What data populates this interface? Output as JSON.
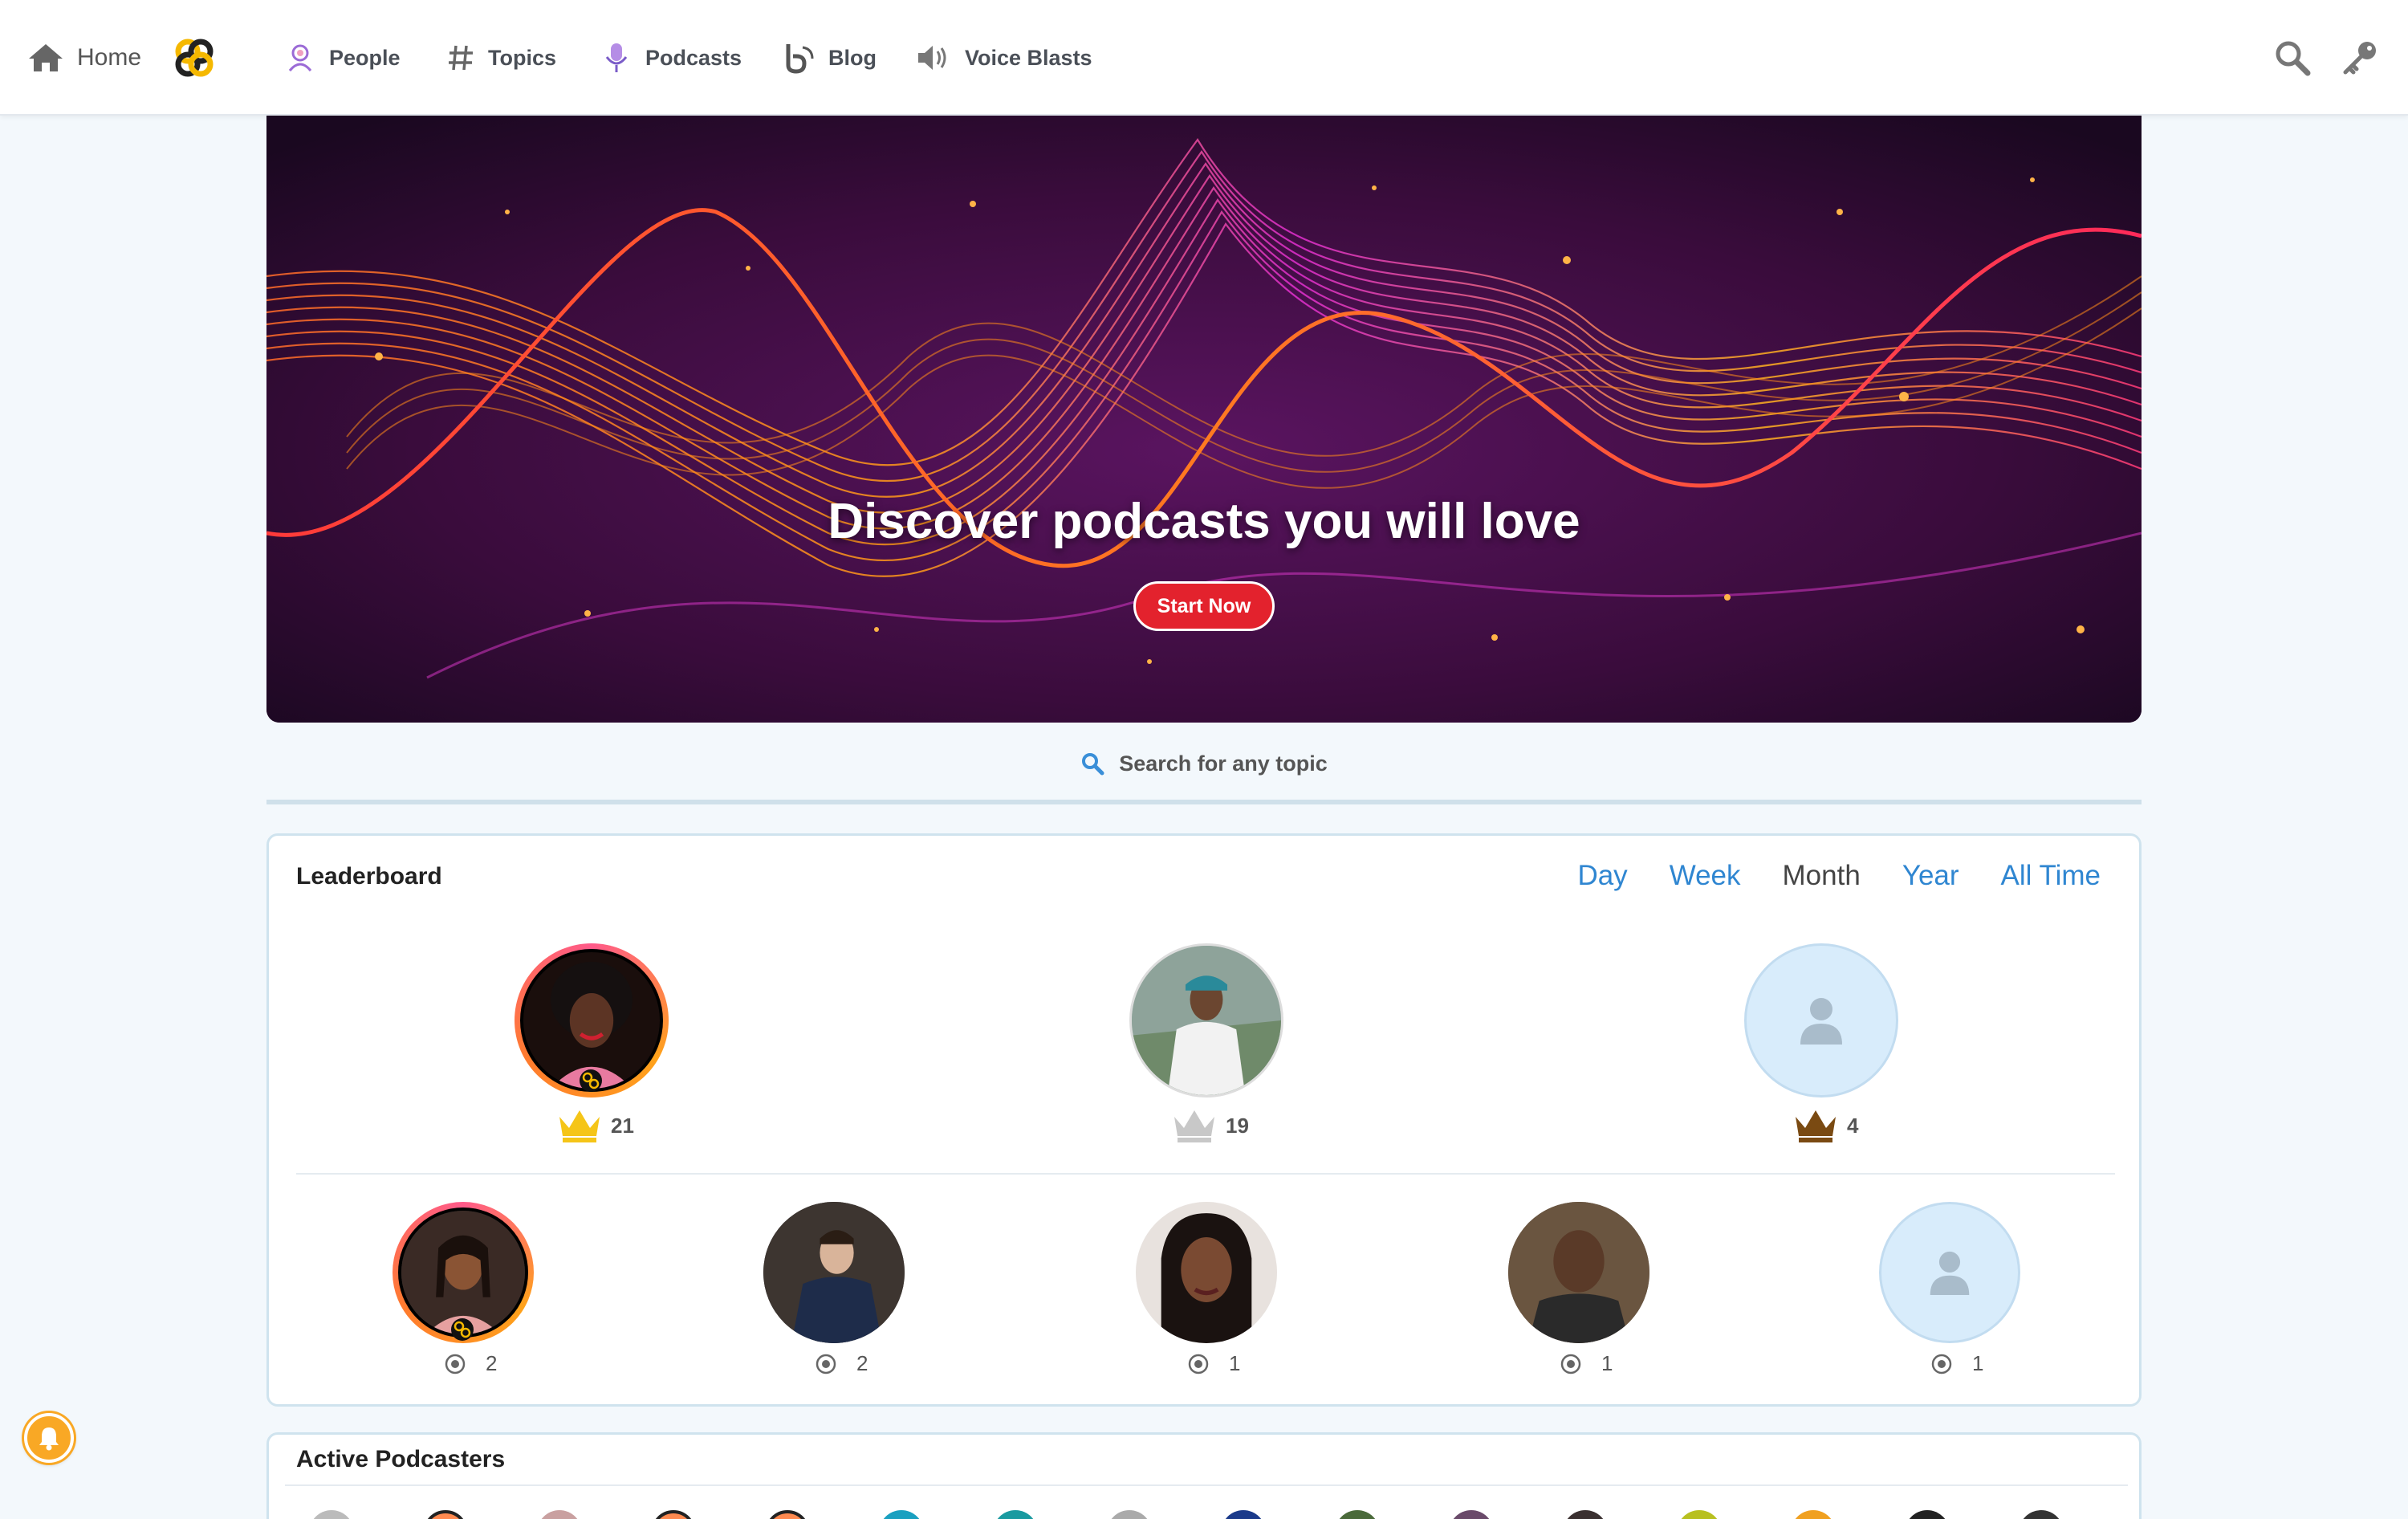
{
  "nav": {
    "home_label": "Home",
    "people_label": "People",
    "topics_label": "Topics",
    "podcasts_label": "Podcasts",
    "blog_label": "Blog",
    "voice_label": "Voice Blasts",
    "icons": [
      "home-icon",
      "brand-logo-icon",
      "people-icon",
      "hashtag-icon",
      "microphone-icon",
      "blog-icon",
      "speaker-icon",
      "search-icon",
      "key-icon"
    ]
  },
  "hero": {
    "title": "Discover podcasts you will love",
    "button_label": "Start Now"
  },
  "search": {
    "label": "Search for any topic"
  },
  "leaderboard": {
    "title": "Leaderboard",
    "tabs": [
      "Day",
      "Week",
      "Month",
      "Year",
      "All Time"
    ],
    "active_tab": "Month",
    "top3": [
      {
        "rank": 1,
        "score": "21",
        "crown": "gold"
      },
      {
        "rank": 2,
        "score": "19",
        "crown": "silver"
      },
      {
        "rank": 3,
        "score": "4",
        "crown": "bronze"
      }
    ],
    "others": [
      {
        "score": "2"
      },
      {
        "score": "2"
      },
      {
        "score": "1"
      },
      {
        "score": "1"
      },
      {
        "score": "1"
      }
    ]
  },
  "active_podcasters": {
    "title": "Active Podcasters"
  },
  "colors": {
    "accent": "#2f86d1",
    "button": "#e3222d",
    "gold": "#f5c518",
    "silver": "#c8c8c8",
    "bronze": "#7a4a12"
  }
}
